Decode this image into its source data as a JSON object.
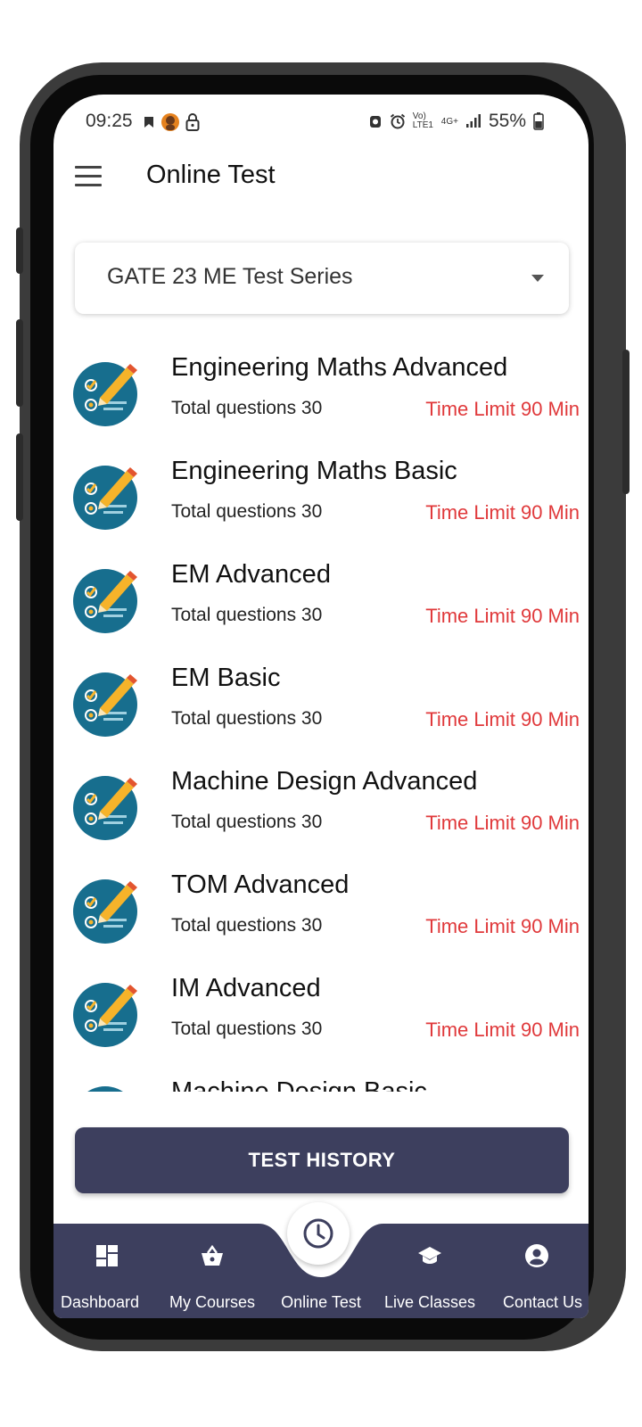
{
  "status_bar": {
    "time": "09:25",
    "battery": "55%",
    "network": "Vo) LTE1",
    "network_type": "4G+"
  },
  "app_bar": {
    "title": "Online Test",
    "menu_icon": "hamburger-icon"
  },
  "selector": {
    "value": "GATE 23 ME Test Series",
    "icon": "chevron-down-icon"
  },
  "tests": [
    {
      "title": "Engineering Maths Advanced",
      "questions": "Total questions 30",
      "time_limit": "Time Limit 90 Min"
    },
    {
      "title": "Engineering Maths Basic",
      "questions": "Total questions 30",
      "time_limit": "Time Limit 90 Min"
    },
    {
      "title": "EM Advanced",
      "questions": "Total questions 30",
      "time_limit": "Time Limit 90 Min"
    },
    {
      "title": "EM Basic",
      "questions": "Total questions 30",
      "time_limit": "Time Limit 90 Min"
    },
    {
      "title": "Machine Design Advanced",
      "questions": "Total questions 30",
      "time_limit": "Time Limit 90 Min"
    },
    {
      "title": "TOM Advanced",
      "questions": "Total questions 30",
      "time_limit": "Time Limit 90 Min"
    },
    {
      "title": "IM Advanced",
      "questions": "Total questions 30",
      "time_limit": "Time Limit 90 Min"
    },
    {
      "title": "Machine Design Basic",
      "questions": "",
      "time_limit": ""
    }
  ],
  "test_history_button": "TEST HISTORY",
  "bottom_nav": [
    {
      "label": "Dashboard",
      "icon": "dashboard-icon"
    },
    {
      "label": "My Courses",
      "icon": "basket-icon"
    },
    {
      "label": "Online Test",
      "icon": "clock-icon"
    },
    {
      "label": "Live Classes",
      "icon": "graduation-cap-icon"
    },
    {
      "label": "Contact Us",
      "icon": "account-circle-icon"
    }
  ],
  "colors": {
    "accent_dark": "#3d3f5e",
    "time_limit_red": "#e0393b",
    "icon_teal": "#176e8e",
    "pencil_yellow": "#f6b32a",
    "frame": "#3b3b3b"
  }
}
